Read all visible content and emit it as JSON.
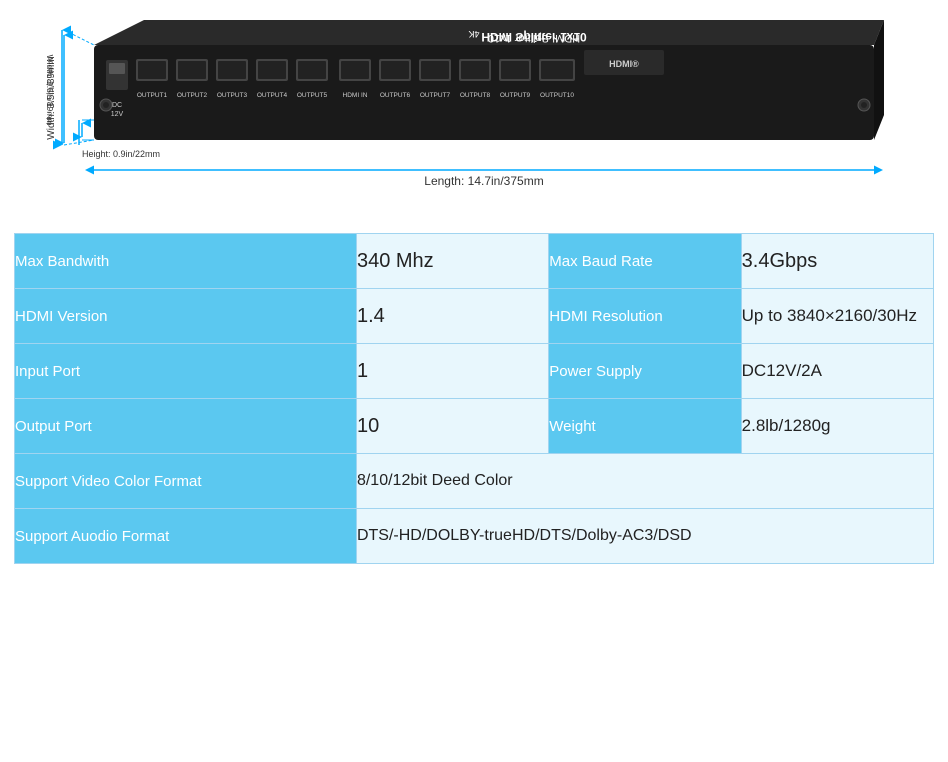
{
  "device": {
    "title": "HDMI Splitter 1x10",
    "subtitle": "4K",
    "dim_width": "Width: 3.5in/89mm",
    "dim_height": "Height: 0.9in/22mm",
    "dim_length": "Length: 14.7in/375mm",
    "ports": [
      "DC 12V",
      "OUTPUT1",
      "OUTPUT2",
      "OUTPUT3",
      "OUTPUT4",
      "OUTPUT5",
      "HDMI IN",
      "OUTPUT6",
      "OUTPUT7",
      "OUTPUT8",
      "OUTPUT9",
      "OUTPUT10"
    ]
  },
  "specs": {
    "rows": [
      {
        "left_label": "Max Bandwith",
        "left_value": "340 Mhz",
        "right_label": "Max Baud Rate",
        "right_value": "3.4Gbps"
      },
      {
        "left_label": "HDMI Version",
        "left_value": "1.4",
        "right_label": "HDMI Resolution",
        "right_value": "Up to 3840×2160/30Hz"
      },
      {
        "left_label": "Input Port",
        "left_value": "1",
        "right_label": "Power Supply",
        "right_value": "DC12V/2A"
      },
      {
        "left_label": "Output Port",
        "left_value": "10",
        "right_label": "Weight",
        "right_value": "2.8lb/1280g"
      }
    ],
    "wide_rows": [
      {
        "label": "Support Video Color Format",
        "value": "8/10/12bit Deed Color"
      },
      {
        "label": "Support  Auodio  Format",
        "value": "DTS/-HD/DOLBY-trueHD/DTS/Dolby-AC3/DSD"
      }
    ]
  }
}
